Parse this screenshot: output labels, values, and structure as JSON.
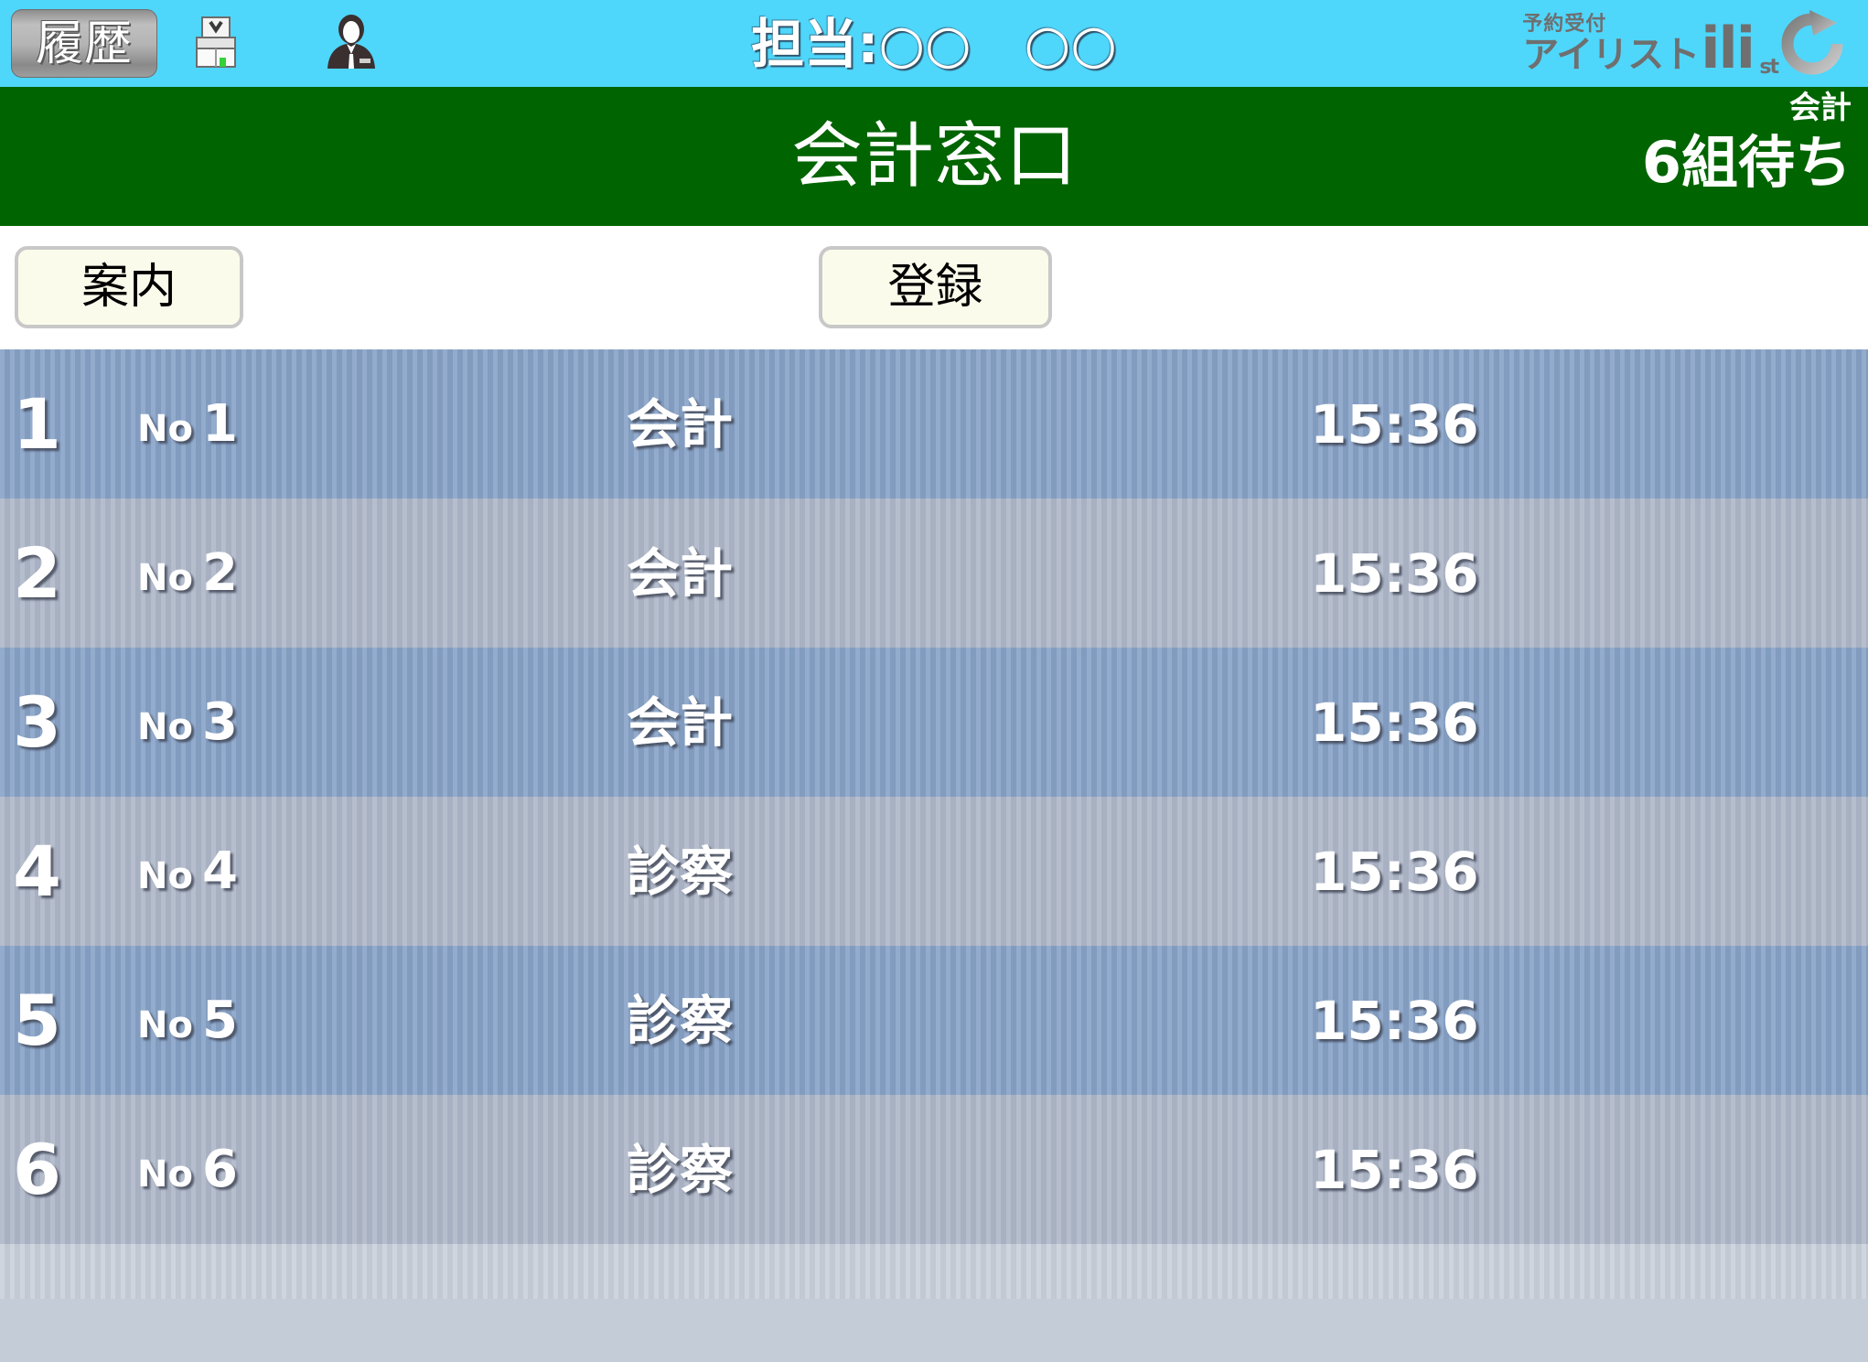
{
  "toolbar": {
    "history_button": "履歴",
    "printer_icon": "printer-icon",
    "person_icon": "staff-person-icon",
    "staff_label": "担当:○○　○○",
    "brand_small": "予約受付",
    "brand_big": "アイリスト",
    "brand_mark": "ili",
    "brand_mark_sub": "st",
    "refresh_icon": "refresh-icon",
    "bg_color": "#4fd6fb"
  },
  "titlebar": {
    "title": "会計窓口",
    "right_sub": "会計",
    "right_count": "6組待ち",
    "bg_color": "#006400"
  },
  "actionbar": {
    "guide_button": "案内",
    "register_button": "登録"
  },
  "queue": {
    "columns": [
      "rank",
      "no",
      "kind",
      "time"
    ],
    "no_prefix": "No",
    "rows": [
      {
        "rank": "1",
        "no": "1",
        "kind": "会計",
        "time": "15:36"
      },
      {
        "rank": "2",
        "no": "2",
        "kind": "会計",
        "time": "15:36"
      },
      {
        "rank": "3",
        "no": "3",
        "kind": "会計",
        "time": "15:36"
      },
      {
        "rank": "4",
        "no": "4",
        "kind": "診察",
        "time": "15:36"
      },
      {
        "rank": "5",
        "no": "5",
        "kind": "診察",
        "time": "15:36"
      },
      {
        "rank": "6",
        "no": "6",
        "kind": "診察",
        "time": "15:36"
      }
    ],
    "row_odd_color": "#87a2c6",
    "row_even_color": "#aeb7c9"
  }
}
